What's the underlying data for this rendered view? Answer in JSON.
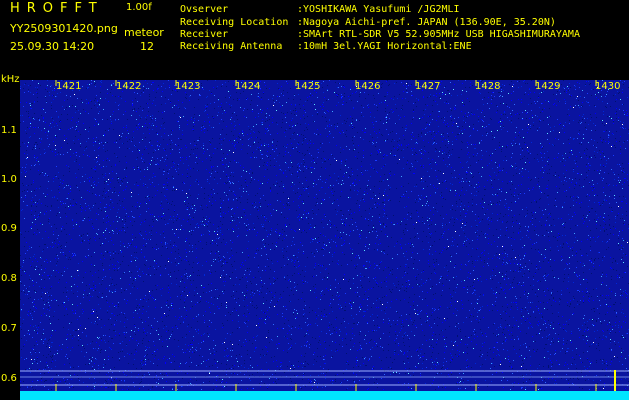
{
  "header": {
    "app_title": "HROFFT",
    "app_version": "1.00f",
    "filename": "YY2509301420.png",
    "meteor_label": "meteor",
    "datetime": "25.09.30 14:20",
    "meteor_count": "12"
  },
  "info": {
    "observer_key": "Ovserver",
    "observer_val": ":YOSHIKAWA Yasufumi /JG2MLI",
    "location_key": "Receiving Location",
    "location_val": ":Nagoya Aichi-pref. JAPAN (136.90E, 35.20N)",
    "receiver_key": "Receiver",
    "receiver_val": ":SMArt RTL-SDR V5 52.905MHz USB HIGASHIMURAYAMA",
    "antenna_key": "Receiving Antenna",
    "antenna_val": ":10mH 3el.YAGI Horizontal:ENE"
  },
  "axes": {
    "y_unit": "kHz",
    "y_labels": [
      "1.1",
      "1.0",
      "0.9",
      "0.8",
      "0.7",
      "0.6"
    ],
    "x_labels": [
      "1421",
      "1422",
      "1423",
      "1424",
      "1425",
      "1426",
      "1427",
      "1428",
      "1429",
      "1430"
    ]
  },
  "colors": {
    "text": "#ffff00",
    "background": "#000000",
    "spectrogram_base": "#0a14a0",
    "bottom_band": "#00e5ff"
  }
}
